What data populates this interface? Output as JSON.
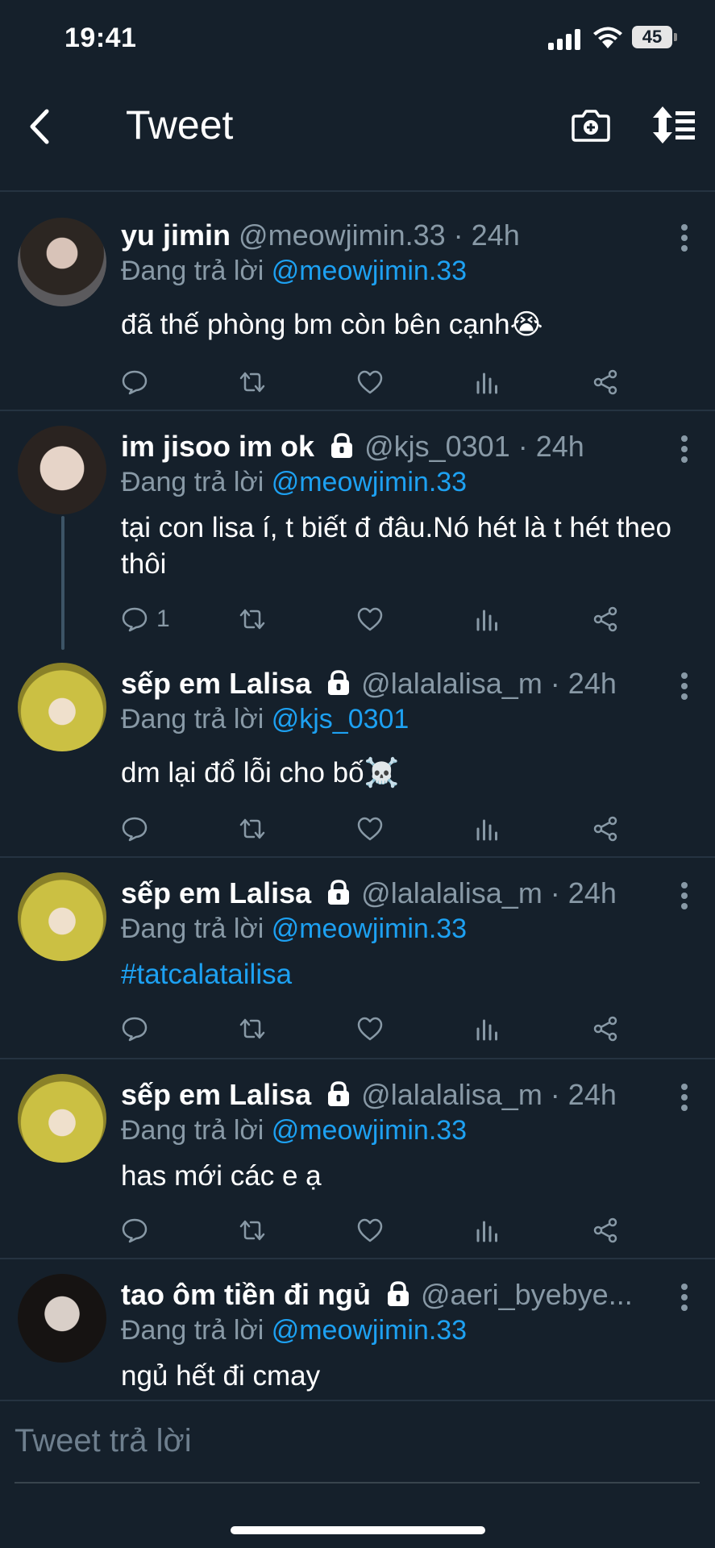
{
  "status_bar": {
    "time": "19:41",
    "battery": "45"
  },
  "nav": {
    "title": "Tweet"
  },
  "reply_prefix": "Đang trả lời",
  "tweets": [
    {
      "name": "yu jimin",
      "meta": "@meowjimin.33 · 24h",
      "reply_to": "@meowjimin.33",
      "text": "đã thế phòng bm còn bên cạnh😭",
      "reply_count": "",
      "locked": false
    },
    {
      "name": "im jisoo im ok",
      "meta": "@kjs_0301 · 24h",
      "reply_to": "@meowjimin.33",
      "text": "tại con lisa í, t biết đ đâu.Nó hét là t hét theo thôi",
      "reply_count": "1",
      "locked": true
    },
    {
      "name": "sếp em Lalisa",
      "meta": "@lalalalisa_m · 24h",
      "reply_to": "@kjs_0301",
      "text": "dm lại đổ lỗi cho bố☠️",
      "reply_count": "",
      "locked": true
    },
    {
      "name": "sếp em Lalisa",
      "meta": "@lalalalisa_m · 24h",
      "reply_to": "@meowjimin.33",
      "text": "#tatcalatailisa",
      "reply_count": "",
      "locked": true
    },
    {
      "name": "sếp em Lalisa",
      "meta": "@lalalalisa_m · 24h",
      "reply_to": "@meowjimin.33",
      "text": "has mới các e ạ",
      "reply_count": "",
      "locked": true
    },
    {
      "name": "tao ôm tiền đi ngủ",
      "meta": "@aeri_byebye...",
      "reply_to": "@meowjimin.33",
      "text": "ngủ hết đi cmay",
      "reply_count": "",
      "locked": true
    }
  ],
  "compose": {
    "placeholder": "Tweet trả lời"
  },
  "colors": {
    "background": "#15202b",
    "accent": "#1da1f2",
    "muted": "#8899a6",
    "divider": "#253341"
  },
  "icons": [
    "back-icon",
    "camera-add-icon",
    "sort-icon",
    "lock-icon",
    "more-icon",
    "reply-icon",
    "retweet-icon",
    "like-icon",
    "stats-icon",
    "share-icon"
  ]
}
